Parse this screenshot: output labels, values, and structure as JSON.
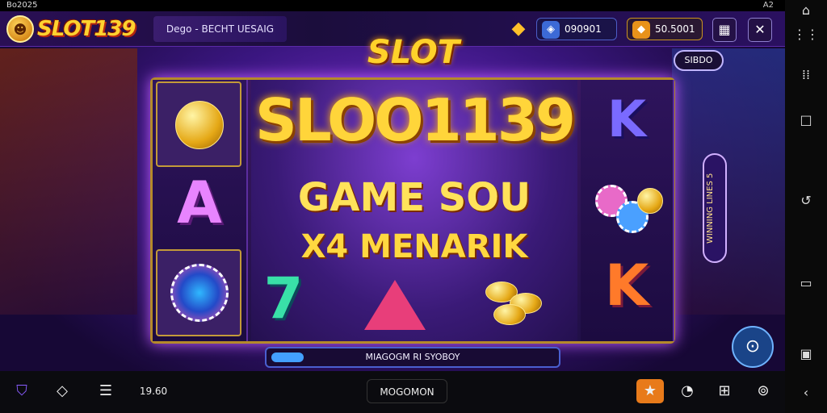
{
  "statusbar": {
    "left": "Bo2025",
    "right": "A2"
  },
  "topbar": {
    "logo_text": "SLOT139",
    "menu_label": "Dego - BECHT UESAIG",
    "balance_blue": "090901",
    "balance_gold": "50.5001"
  },
  "game": {
    "sign": "SLOT",
    "headline_1": "SLOO1139",
    "headline_2": "GAME SOU",
    "headline_3": "X4 MENARIK",
    "chip_button": "SIBDO",
    "side_panel": "WINNING LINES 5",
    "reel_symbol_a": "A",
    "reel_symbol_k1": "K",
    "reel_symbol_k2": "K",
    "reel_symbol_7": "7",
    "progress_label": "MIAGOGM RI SYOBOY"
  },
  "bottombar": {
    "balance": "19.60",
    "center_label": "MOGOMON"
  },
  "colors": {
    "accent": "#ffd22a",
    "brand_red": "#b3260e",
    "purple": "#5b2aa8"
  }
}
